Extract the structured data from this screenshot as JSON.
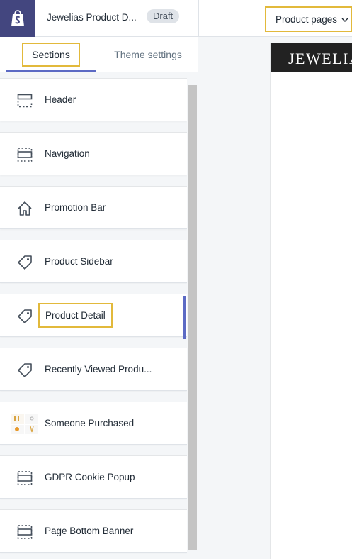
{
  "topbar": {
    "theme_name": "Jewelias Product D...",
    "status_badge": "Draft",
    "page_selector": "Product pages"
  },
  "sidebar": {
    "tabs": [
      {
        "label": "Sections",
        "active": true
      },
      {
        "label": "Theme settings",
        "active": false
      }
    ],
    "sections": [
      {
        "label": "Header",
        "icon": "header-layout-icon"
      },
      {
        "label": "Navigation",
        "icon": "section-layout-icon"
      },
      {
        "label": "Promotion Bar",
        "icon": "home-icon"
      },
      {
        "label": "Product Sidebar",
        "icon": "tag-icon"
      },
      {
        "label": "Product Detail",
        "icon": "tag-icon",
        "active": true
      },
      {
        "label": "Recently Viewed Produ...",
        "icon": "tag-icon"
      },
      {
        "label": "Someone Purchased",
        "icon": "product-thumbnails-icon"
      },
      {
        "label": "GDPR Cookie Popup",
        "icon": "section-layout-icon"
      },
      {
        "label": "Page Bottom Banner",
        "icon": "section-layout-icon"
      }
    ]
  },
  "preview": {
    "store_name": "JEWELIA"
  },
  "colors": {
    "brand": "#43467f",
    "accent": "#5c6ac4",
    "highlight": "#e2b93b"
  }
}
